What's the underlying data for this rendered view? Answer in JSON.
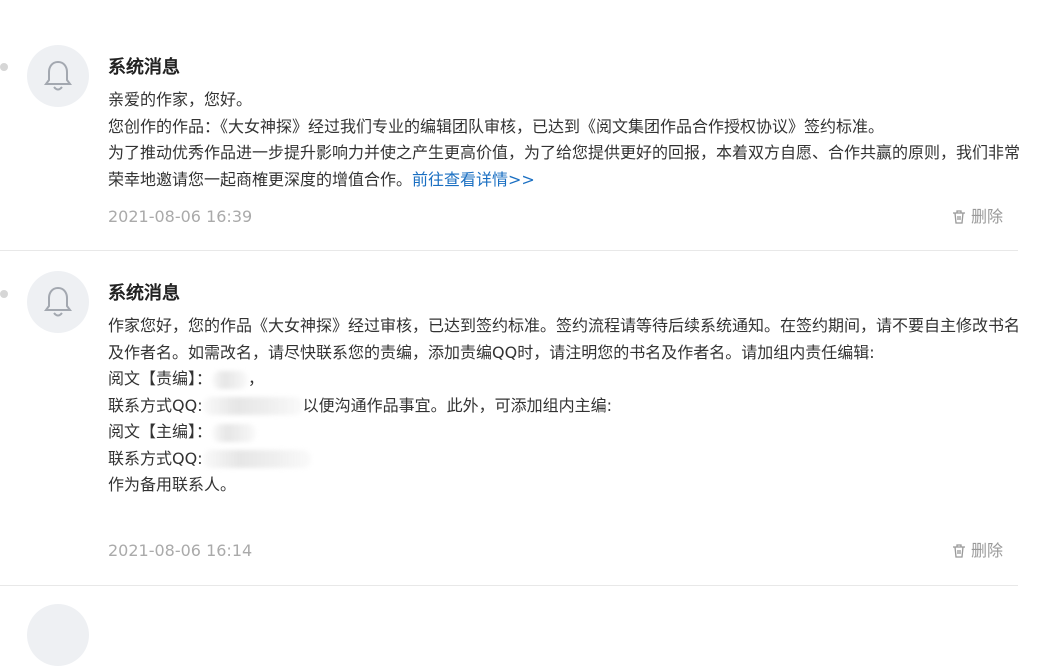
{
  "messages": [
    {
      "title": "系统消息",
      "lines": [
        "亲爱的作家，您好。",
        "您创作的作品：《大女神探》经过我们专业的编辑团队审核，已达到《阅文集团作品合作授权协议》签约标准。",
        "为了推动优秀作品进一步提升影响力并使之产生更高价值，为了给您提供更好的回报，本着双方自愿、合作共赢的原则，我们非常荣幸地邀请您一起商榷更深度的增值合作。"
      ],
      "link": "前往查看详情>>",
      "time": "2021-08-06 16:39",
      "delete_label": "删除"
    },
    {
      "title": "系统消息",
      "line1": "作家您好，您的作品《大女神探》经过审核，已达到签约标准。签约流程请等待后续系统通知。在签约期间，请不要自主修改书名及作者名。如需改名，请尽快联系您的责编，添加责编QQ时，请注明您的书名及作者名。请加组内责任编辑:",
      "line2": "阅文【责编】：",
      "line2_tail": "，",
      "line3_prefix": "联系方式QQ:",
      "line3_suffix": "以便沟通作品事宜。此外，可添加组内主编:",
      "line4": "阅文【主编】：",
      "line5_prefix": "联系方式QQ:",
      "line6": "作为备用联系人。",
      "time": "2021-08-06 16:14",
      "delete_label": "删除"
    }
  ],
  "icons": {
    "avatar": "bell-icon",
    "delete": "trash-icon"
  },
  "colors": {
    "link": "#1a6fc2",
    "time": "#aaaaaa",
    "avatar_bg": "#eef0f3"
  }
}
